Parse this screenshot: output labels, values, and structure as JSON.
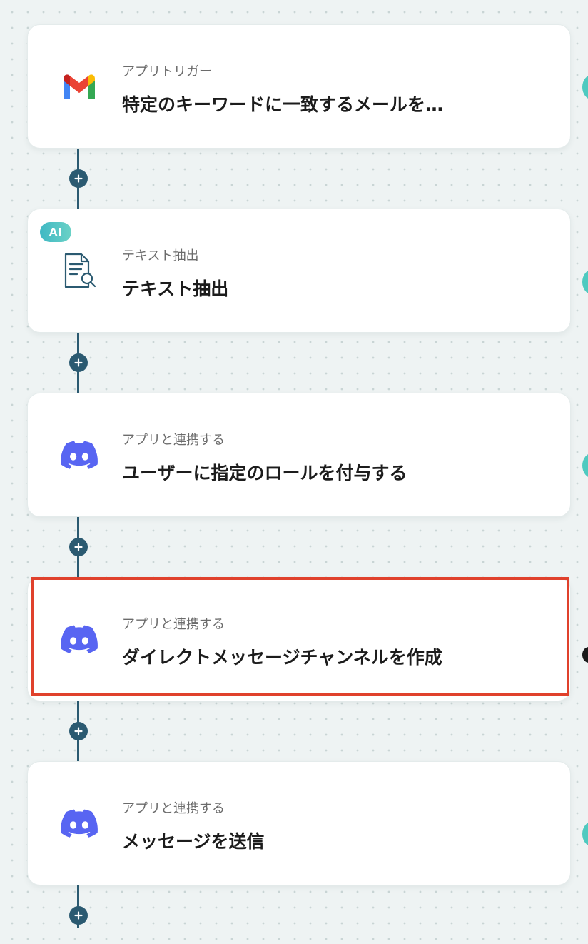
{
  "steps": [
    {
      "subtitle": "アプリトリガー",
      "title": "特定のキーワードに一致するメールを…",
      "icon": "gmail-icon"
    },
    {
      "subtitle": "テキスト抽出",
      "title": "テキスト抽出",
      "icon": "document-search-icon",
      "badge": "AI"
    },
    {
      "subtitle": "アプリと連携する",
      "title": "ユーザーに指定のロールを付与する",
      "icon": "discord-icon"
    },
    {
      "subtitle": "アプリと連携する",
      "title": "ダイレクトメッセージチャンネルを作成",
      "icon": "discord-icon",
      "highlighted": true
    },
    {
      "subtitle": "アプリと連携する",
      "title": "メッセージを送信",
      "icon": "discord-icon"
    }
  ],
  "colors": {
    "connector": "#2b5a71",
    "highlight": "#e0412c",
    "discord": "#5865f2",
    "ai_badge": "#3fb8c4"
  }
}
